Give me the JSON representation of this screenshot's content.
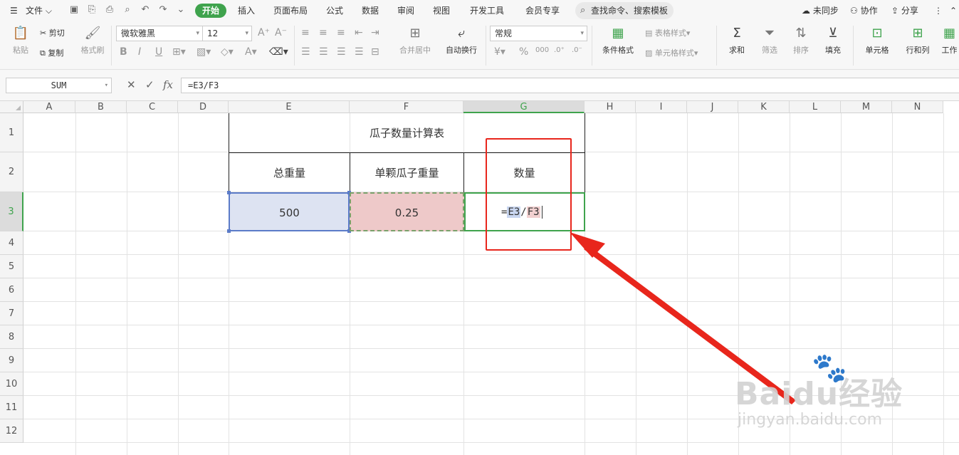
{
  "menubar": {
    "file": "文件",
    "tabs": [
      "开始",
      "插入",
      "页面布局",
      "公式",
      "数据",
      "审阅",
      "视图",
      "开发工具",
      "会员专享"
    ],
    "active_tab": "开始",
    "search_placeholder": "查找命令、搜索模板",
    "sync": "未同步",
    "collab": "协作",
    "share": "分享"
  },
  "ribbon": {
    "paste": "粘贴",
    "cut": "剪切",
    "copy": "复制",
    "format_painter": "格式刷",
    "font_name": "微软雅黑",
    "font_size": "12",
    "merge_center": "合并居中",
    "wrap_text": "自动换行",
    "number_format": "常规",
    "conditional_format": "条件格式",
    "table_style": "表格样式",
    "cell_style": "单元格样式",
    "sum": "求和",
    "filter": "筛选",
    "sort": "排序",
    "fill": "填充",
    "cell": "单元格",
    "row_col": "行和列",
    "worksheet": "工作"
  },
  "formula_bar": {
    "name_box": "SUM",
    "fx_label": "fx",
    "formula": "=E3/F3"
  },
  "grid": {
    "columns": [
      "A",
      "B",
      "C",
      "D",
      "E",
      "F",
      "G",
      "H",
      "I",
      "J",
      "K",
      "L",
      "M",
      "N"
    ],
    "selected_column": "G",
    "rows": [
      "1",
      "2",
      "3",
      "4",
      "5",
      "6",
      "7",
      "8",
      "9",
      "10",
      "11",
      "12"
    ],
    "selected_row": "3",
    "title": "瓜子数量计算表",
    "headers": [
      "总重量",
      "单颗瓜子重量",
      "数量"
    ],
    "values": [
      "500",
      "0.25"
    ],
    "editing_formula": {
      "eq": "=",
      "ref1": "E3",
      "slash": "/",
      "ref2": "F3"
    }
  },
  "watermark": {
    "brand": "Baidu经验",
    "url": "jingyan.baidu.com"
  },
  "colors": {
    "accent": "#3fa34d",
    "annotation_red": "#e8261c",
    "ref1_fill": "#dde3f2",
    "ref2_fill": "#eec9c9"
  }
}
